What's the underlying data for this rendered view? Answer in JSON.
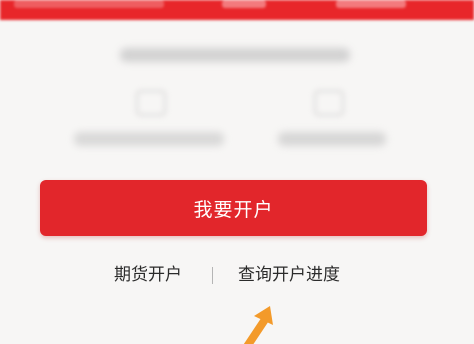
{
  "main_button": {
    "label": "我要开户"
  },
  "links": {
    "futures_account": "期货开户",
    "divider": "|",
    "query_progress": "查询开户进度"
  },
  "colors": {
    "brand_red": "#e2262b",
    "arrow_orange": "#f39a2a"
  },
  "icons": {
    "arrow": "arrow-up-right-icon"
  }
}
